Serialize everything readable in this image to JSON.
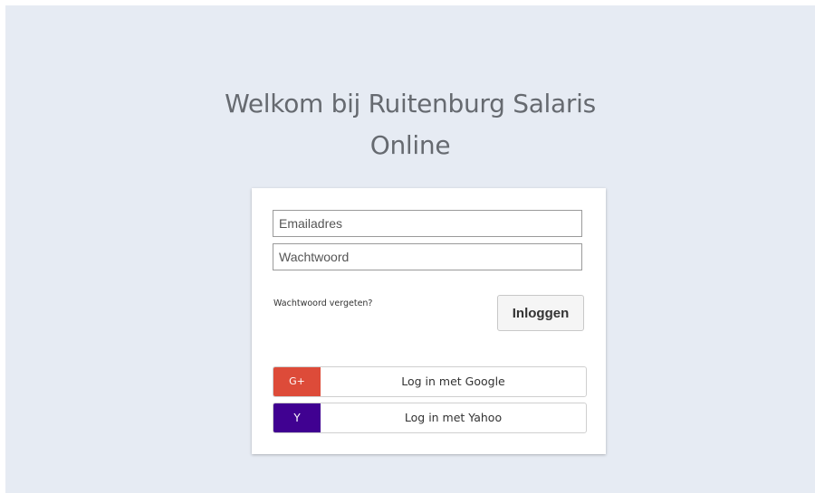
{
  "header": {
    "title_line1": "Welkom bij Ruitenburg Salaris",
    "title_line2": "Online"
  },
  "login_form": {
    "email_placeholder": "Emailadres",
    "email_value": "",
    "password_placeholder": "Wachtwoord",
    "password_value": "",
    "forgot_password_label": "Wachtwoord vergeten?",
    "login_button_label": "Inloggen"
  },
  "social_logins": {
    "google": {
      "icon_text": "G+",
      "label": "Log in met Google",
      "color": "#dd4b39",
      "icon": "google-plus-icon"
    },
    "yahoo": {
      "icon_text": "Y",
      "label": "Log in met Yahoo",
      "color": "#400191",
      "icon": "yahoo-icon"
    }
  },
  "colors": {
    "page_background": "#e6ebf3",
    "card_background": "#ffffff",
    "title_text": "#666a70"
  }
}
